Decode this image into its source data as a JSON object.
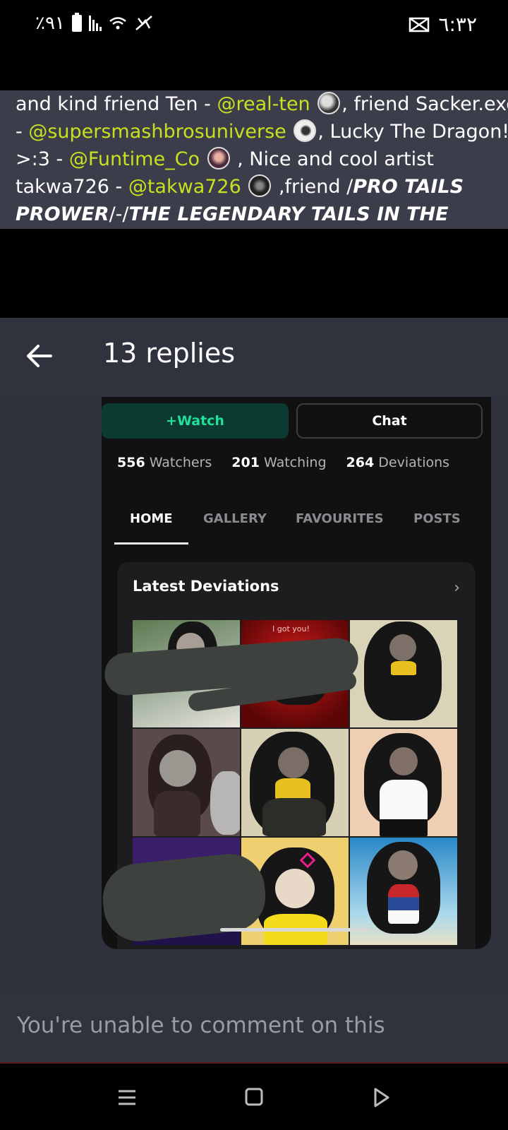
{
  "status_bar": {
    "battery_text": "٪٩١",
    "time": "٦:٣٢"
  },
  "post": {
    "line1_pre": "and kind friend Ten - ",
    "line1_mention": "@real-ten",
    "line1_post": ", friend Sacker.exe",
    "line2_pre": "- ",
    "line2_mention": "@supersmashbrosuniverse",
    "line2_post": ", Lucky The Dragon!",
    "line3_pre": ">:3 - ",
    "line3_mention": "@Funtime_Co",
    "line3_post": " , Nice and cool artist",
    "line4_pre": "takwa726 - ",
    "line4_mention": "@takwa726",
    "line4_post": " ,friend /",
    "line4_bold": "PRO TAILS",
    "line5_bold1": "PROWER",
    "line5_sep": "/-/",
    "line5_bold2": "THE LEGENDARY TAILS IN THE"
  },
  "header": {
    "title": "13 replies"
  },
  "profile_shot": {
    "watch_label": "+Watch",
    "chat_label": "Chat",
    "stats": [
      {
        "count": "556",
        "label": "Watchers"
      },
      {
        "count": "201",
        "label": "Watching"
      },
      {
        "count": "264",
        "label": "Deviations"
      }
    ],
    "tabs": [
      "HOME",
      "GALLERY",
      "FAVOURITES",
      "POSTS"
    ],
    "latest_title": "Latest Deviations",
    "thumb_caption": "I got you!"
  },
  "comment": {
    "placeholder": "You're unable to comment on this"
  },
  "colors": {
    "mention": "#c7e01f",
    "watch_text": "#22e09a",
    "header_bg": "#30323e"
  }
}
